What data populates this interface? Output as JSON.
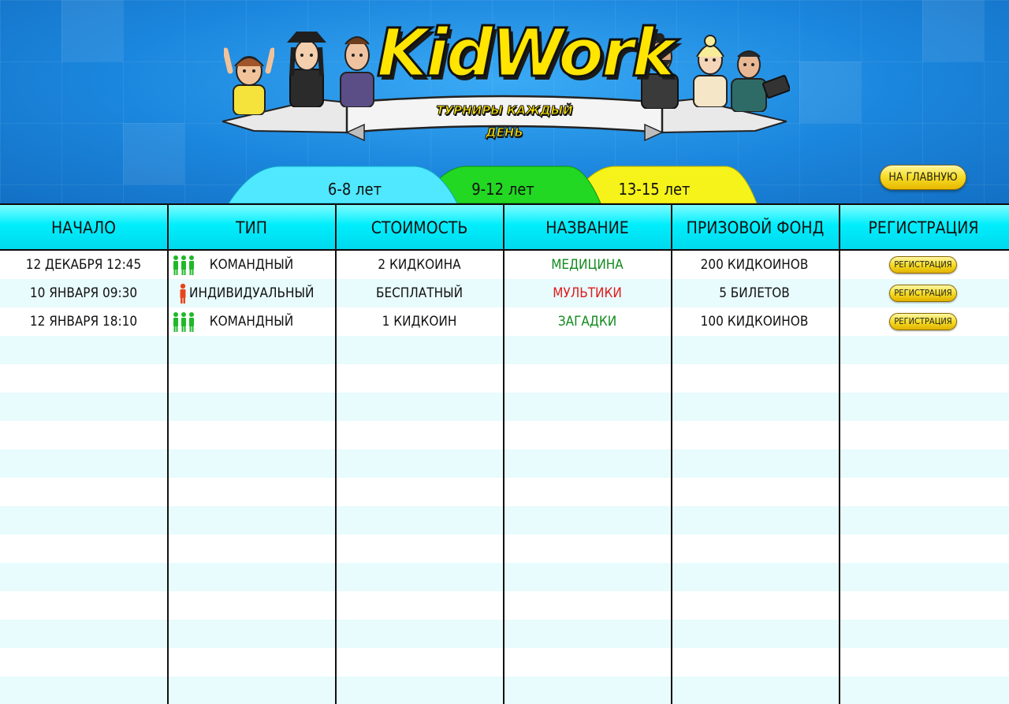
{
  "header": {
    "logo_text": "KidWork",
    "ribbon_text": "ТУРНИРЫ КАЖДЫЙ ДЕНЬ",
    "home_button": "НА ГЛАВНУЮ",
    "tabs": [
      {
        "label": "6-8 лет",
        "color": "#4fe8ff",
        "active": true
      },
      {
        "label": "9-12 лет",
        "color": "#22d822",
        "active": false
      },
      {
        "label": "13-15 лет",
        "color": "#f6f31a",
        "active": false
      }
    ]
  },
  "table": {
    "columns": [
      "НАЧАЛО",
      "ТИП",
      "СТОИМОСТЬ",
      "НАЗВАНИЕ",
      "ПРИЗОВОЙ ФОНД",
      "РЕГИСТРАЦИЯ"
    ],
    "rows": [
      {
        "start": "12 ДЕКАБРЯ 12:45",
        "type": "КОМАНДНЫЙ",
        "type_icon": "team-icon",
        "cost": "2 КИДКОИНА",
        "name": "МЕДИЦИНА",
        "name_color": "green",
        "prize": "200 КИДКОИНОВ",
        "register": "РЕГИСТРАЦИЯ"
      },
      {
        "start": "10 ЯНВАРЯ 09:30",
        "type": "ИНДИВИДУАЛЬНЫЙ",
        "type_icon": "person-icon",
        "cost": "БЕСПЛАТНЫЙ",
        "name": "МУЛЬТИКИ",
        "name_color": "red",
        "prize": "5 БИЛЕТОВ",
        "register": "РЕГИСТРАЦИЯ"
      },
      {
        "start": "12 ЯНВАРЯ 18:10",
        "type": "КОМАНДНЫЙ",
        "type_icon": "team-icon",
        "cost": "1 КИДКОИН",
        "name": "ЗАГАДКИ",
        "name_color": "green",
        "prize": "100 КИДКОИНОВ",
        "register": "РЕГИСТРАЦИЯ"
      }
    ]
  },
  "colors": {
    "header_blue": "#1e8fe3",
    "header_cyan": "#00eefc",
    "team_green": "#1fb829",
    "person_orange": "#e8461a",
    "button_yellow": "#f5dc26"
  }
}
